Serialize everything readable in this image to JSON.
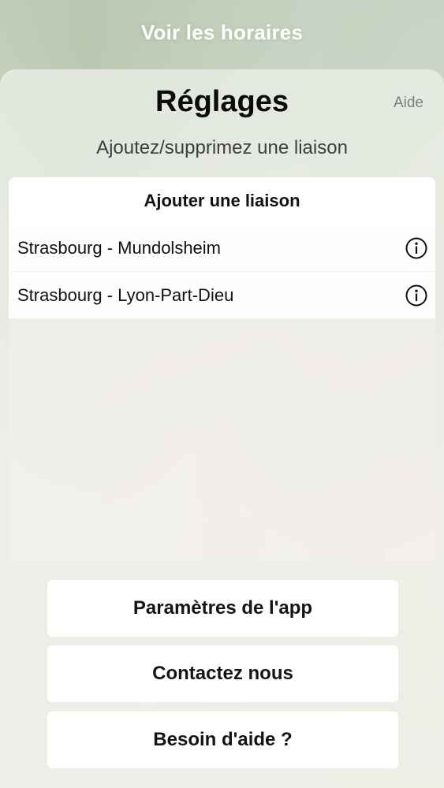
{
  "header": {
    "top_title": "Voir les horaires"
  },
  "sheet": {
    "title": "Réglages",
    "help_label": "Aide",
    "subtitle": "Ajoutez/supprimez une liaison"
  },
  "routes": {
    "add_label": "Ajouter une liaison",
    "items": [
      {
        "label": "Strasbourg - Mundolsheim",
        "icon": "info-icon"
      },
      {
        "label": "Strasbourg - Lyon-Part-Dieu",
        "icon": "info-icon"
      }
    ]
  },
  "buttons": {
    "app_settings": "Paramètres de l'app",
    "contact": "Contactez nous",
    "need_help": "Besoin d'aide ?"
  }
}
